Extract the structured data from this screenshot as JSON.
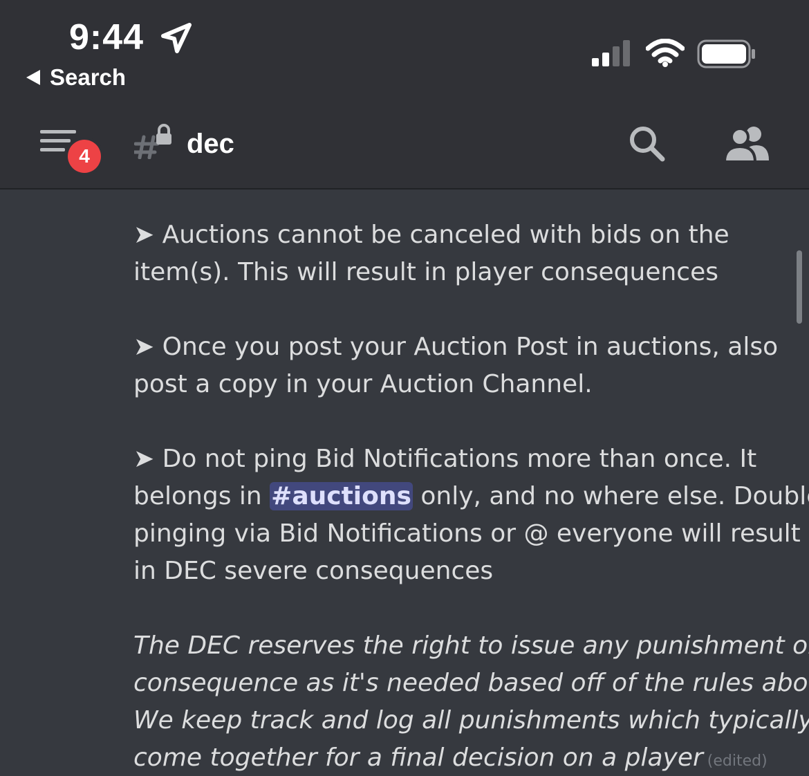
{
  "status_bar": {
    "time": "9:44",
    "back_label": "Search",
    "icons": [
      "location-arrow-icon",
      "cellular-signal-icon",
      "wifi-icon",
      "battery-icon"
    ]
  },
  "header": {
    "badge_count": "4",
    "channel_name": "dec",
    "icons": [
      "channel-list-menu-icon",
      "locked-channel-icon",
      "search-icon",
      "members-icon"
    ]
  },
  "messages": {
    "rule1": {
      "arrow": "➤",
      "line1": " Auctions cannot be canceled with bids on the",
      "line2": "item(s). This will result in player consequences"
    },
    "rule2": {
      "arrow": "➤",
      "line1": " Once you post your Auction Post in auctions, also",
      "line2": "post a copy in your Auction Channel."
    },
    "rule3": {
      "arrow": "➤",
      "line1": " Do not ping Bid Notifications more than once. It",
      "line2_before": "belongs in ",
      "mention": "#auctions",
      "line2_after": " only, and no where else. Double",
      "line3": "pinging via Bid Notifications or @ everyone will result",
      "line4": "in DEC severe consequences"
    },
    "footer": {
      "line1": "The DEC reserves the right to issue any punishment or",
      "line2": "consequence as it's needed based off of the rules above.",
      "line3": "We keep track and log all punishments which typically",
      "line4": "come together for a final decision on a player",
      "edited": "(edited)"
    }
  },
  "colors": {
    "background": "#36393f",
    "header_background": "#303136",
    "text": "#dcddde",
    "badge": "#ed4245",
    "mention_bg": "#5865f2",
    "muted": "#72767d"
  }
}
